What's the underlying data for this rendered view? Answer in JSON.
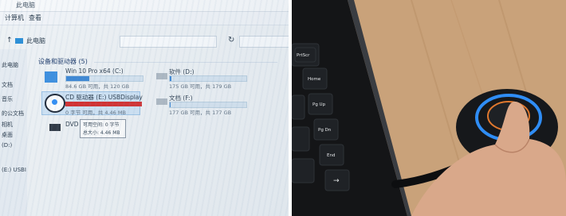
{
  "left_photo": {
    "title": "此电脑",
    "tab_computer": "计算机",
    "tab_view": "查看",
    "breadcrumb": "此电脑",
    "group_header": "设备和驱动器 (5)",
    "drives": [
      {
        "name": "Win 10 Pro x64 (C:)",
        "info": "84.6 GB 可用，共 120 GB",
        "used_fraction": 0.3
      },
      {
        "name": "软件 (D:)",
        "info": "175 GB 可用，共 179 GB",
        "used_fraction": 0.02
      },
      {
        "name": "CD 驱动器 (E:) USBDisplay",
        "info": "0 字节 可用，共 4.46 MB",
        "used_fraction": 1.0
      },
      {
        "name": "文档 (F:)",
        "info": "177 GB 可用，共 177 GB",
        "used_fraction": 0.01
      },
      {
        "name": "DVD 驱动器 (G:)",
        "info": ""
      }
    ],
    "tooltip_line1": "可用空间: 0 字节",
    "tooltip_line2": "总大小: 4.46 MB",
    "sidebar_fragments": [
      "此电脑",
      "文档",
      "音乐",
      "的公文档",
      "相机",
      "桌面",
      "(D:)",
      "(E:) USBI"
    ],
    "colors": {
      "usage_bar": "#3a86d4",
      "full_bar": "#d42a2a",
      "window_bg": "#eef2f5"
    }
  },
  "right_photo": {
    "keys": [
      "PrtScr",
      "Home",
      "Pg Up",
      "Pg Dn",
      "End",
      "→"
    ],
    "colors": {
      "desk": "#c9a27a",
      "laptop": "#141517",
      "dongle": "#16181b",
      "led_ring": "#2f8df5",
      "touch_ring": "#e0782e"
    }
  }
}
